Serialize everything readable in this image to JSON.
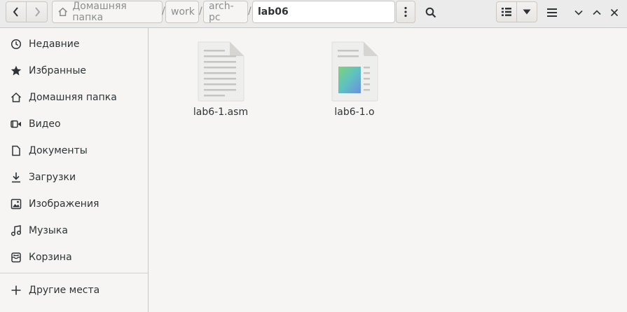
{
  "breadcrumb": {
    "home": "Домашняя папка",
    "items": [
      "work",
      "arch-pc"
    ],
    "current": "lab06",
    "separator": "/"
  },
  "sidebar": {
    "items": [
      {
        "label": "Недавние",
        "icon": "clock-icon"
      },
      {
        "label": "Избранные",
        "icon": "star-icon"
      },
      {
        "label": "Домашняя папка",
        "icon": "home-icon"
      },
      {
        "label": "Видео",
        "icon": "video-icon"
      },
      {
        "label": "Документы",
        "icon": "document-icon"
      },
      {
        "label": "Загрузки",
        "icon": "download-icon"
      },
      {
        "label": "Изображения",
        "icon": "image-icon"
      },
      {
        "label": "Музыка",
        "icon": "music-icon"
      },
      {
        "label": "Корзина",
        "icon": "trash-icon"
      }
    ],
    "other_locations": {
      "label": "Другие места",
      "icon": "plus-icon"
    }
  },
  "files": [
    {
      "name": "lab6-1.asm",
      "type": "text"
    },
    {
      "name": "lab6-1.o",
      "type": "object"
    }
  ]
}
